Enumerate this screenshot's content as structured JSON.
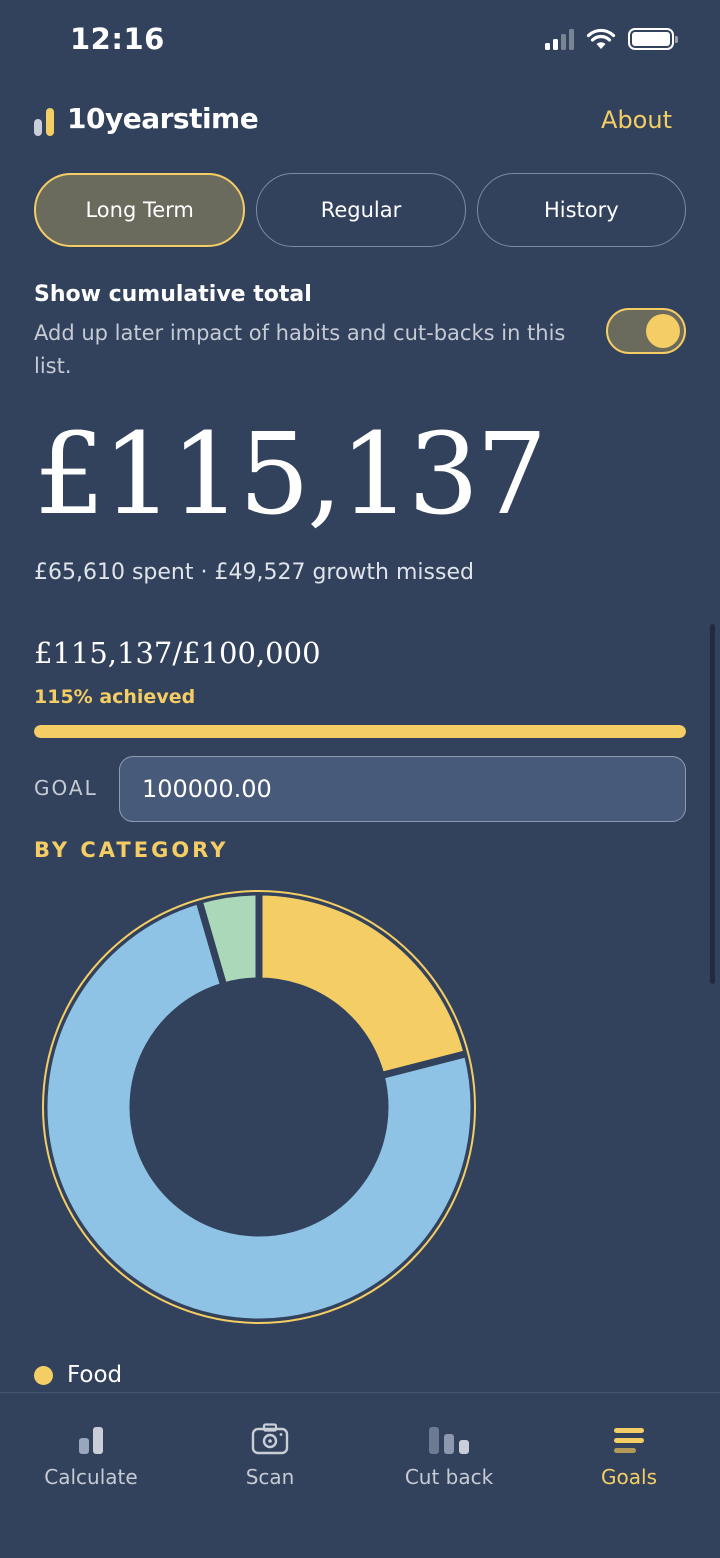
{
  "status_bar": {
    "time": "12:16"
  },
  "header": {
    "app_title": "10yearstime",
    "about_label": "About"
  },
  "tabs": [
    {
      "label": "Long Term",
      "active": true
    },
    {
      "label": "Regular",
      "active": false
    },
    {
      "label": "History",
      "active": false
    }
  ],
  "cumulative": {
    "title": "Show cumulative total",
    "description": "Add up later impact of habits and cut-backs in this list.",
    "enabled": true
  },
  "summary": {
    "total": "£115,137",
    "breakdown": "£65,610 spent · £49,527 growth missed",
    "goal_progress": "£115,137/£100,000",
    "achieved": "115% achieved",
    "progress_fraction": 1.0
  },
  "goal": {
    "label": "GOAL",
    "value": "100000.00"
  },
  "category": {
    "title": "BY CATEGORY",
    "legend": [
      {
        "label": "Food",
        "color": "#f4cd64"
      }
    ]
  },
  "chart_data": {
    "type": "pie",
    "slices": [
      {
        "color": "#f4cd64",
        "fraction": 0.21
      },
      {
        "color": "#8fc3e6",
        "fraction": 0.745
      },
      {
        "color": "#acd8ba",
        "fraction": 0.045
      }
    ]
  },
  "nav": [
    {
      "label": "Calculate",
      "icon": "calculate-icon",
      "active": false
    },
    {
      "label": "Scan",
      "icon": "scan-icon",
      "active": false
    },
    {
      "label": "Cut back",
      "icon": "cut-back-icon",
      "active": false
    },
    {
      "label": "Goals",
      "icon": "goals-icon",
      "active": true
    }
  ],
  "colors": {
    "background": "#32425c",
    "accent": "#f4cd64"
  }
}
